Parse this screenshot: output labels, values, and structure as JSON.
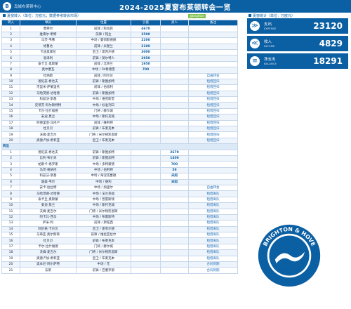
{
  "banner": {
    "org": "岛城布莱顿中心",
    "title": "2024-2025夏窗布莱顿转会一览",
    "logo_text": "B"
  },
  "left_head": "夏窗转入（单位：万欧元；数据参考转会市场）",
  "badge": "@brighton",
  "columns": [
    "转入",
    "球员",
    "位置",
    "引援",
    "卖人",
    "备注"
  ],
  "transfers_in": [
    {
      "no": "1",
      "player": "鲁特尔",
      "pos": "前锋 / 科拉巴",
      "fee": "4670",
      "sold": "",
      "note": ""
    },
    {
      "no": "2",
      "player": "维南尔·明特",
      "pos": "前锋 / 铭主",
      "fee": "3500",
      "sold": "",
      "note": ""
    },
    {
      "no": "3",
      "player": "马茨·韦弗",
      "pos": "中场 / 曼彻斯德赫",
      "fee": "2200",
      "sold": "",
      "note": ""
    },
    {
      "no": "4",
      "player": "格鲁达",
      "pos": "前锋 / 米图兰",
      "fee": "2100",
      "sold": "",
      "note": ""
    },
    {
      "no": "5",
      "player": "卡迪奥库尼",
      "pos": "后卫 / 席内尔德",
      "fee": "3000",
      "sold": "",
      "note": ""
    },
    {
      "no": "6",
      "player": "恩泽利",
      "pos": "前锋 / 莫尔特人",
      "fee": "2950",
      "sold": "",
      "note": ""
    },
    {
      "no": "7",
      "player": "泰卡丘·奥斯蒙",
      "pos": "前锋 / 北英兰",
      "fee": "1950",
      "sold": "",
      "note": ""
    },
    {
      "no": "8",
      "player": "奥尔塞瓦",
      "pos": "中场 / FK希德堡",
      "fee": "700",
      "sold": "",
      "note": ""
    },
    {
      "no": "9",
      "player": "杜纳斯",
      "pos": "前锋 / 阿尔达",
      "fee": "",
      "sold": "",
      "note": "自由转会"
    },
    {
      "no": "10",
      "player": "德尼兹·希达夫",
      "pos": "前锋 / 斯图加特",
      "fee": "",
      "sold": "",
      "note": "租借回归"
    },
    {
      "no": "11",
      "player": "杰里米·萨蒙里托",
      "pos": "前锋 / 伯恩利",
      "fee": "",
      "sold": "",
      "note": "租借回归"
    },
    {
      "no": "12",
      "player": "马哈茂德·达哈德",
      "pos": "前锋 / 斯图加特",
      "fee": "",
      "sold": "",
      "note": "租借回归"
    },
    {
      "no": "13",
      "player": "科兹沃·斯基",
      "pos": "中场 / 维克斯堡",
      "fee": "",
      "sold": "",
      "note": "租借回归"
    },
    {
      "no": "14",
      "player": "史蒂芬·阿尔斯特特",
      "pos": "中场 / 标准列日",
      "fee": "",
      "sold": "",
      "note": "租借回归"
    },
    {
      "no": "15",
      "player": "卡尔·拉什福德",
      "pos": "门将 / 赫尔城",
      "fee": "",
      "sold": "",
      "note": "租借回归"
    },
    {
      "no": "16",
      "player": "安迪·莫兰",
      "pos": "中场 / 斯托克城",
      "fee": "",
      "sold": "",
      "note": "租借回归"
    },
    {
      "no": "17",
      "player": "阿德里亚·马内卢",
      "pos": "前锋 / 维利特",
      "fee": "",
      "sold": "",
      "note": "租借回归"
    },
    {
      "no": "18",
      "player": "杜贝贝",
      "pos": "前锋 / 布莱克本",
      "fee": "",
      "sold": "",
      "note": "租借回归"
    },
    {
      "no": "19",
      "player": "沃姆·麦吉尔",
      "pos": "门将 / 米尔顿凯恩斯",
      "fee": "",
      "sold": "",
      "note": "租借回归"
    },
    {
      "no": "20",
      "player": "奥德卢加·希菲亚",
      "pos": "后卫 / 布莱克本",
      "fee": "",
      "sold": "",
      "note": "租借回归"
    }
  ],
  "out_label": "转出",
  "transfers_out": [
    {
      "no": "1",
      "player": "德尼兹·希达夫",
      "pos": "前锋 / 斯图加特",
      "fee": "",
      "sold": "2670",
      "note": ""
    },
    {
      "no": "2",
      "player": "比利·布尔夫",
      "pos": "前锋 / 斯图加特",
      "fee": "",
      "sold": "1400",
      "note": ""
    },
    {
      "no": "3",
      "player": "帕斯卡·格罗斯",
      "pos": "中场 / 多特蒙德",
      "fee": "",
      "sold": "700",
      "note": ""
    },
    {
      "no": "4",
      "player": "马茨·格纳内",
      "pos": "中场 / 伯利特",
      "fee": "",
      "sold": "59",
      "note": ""
    },
    {
      "no": "5",
      "player": "科兹沃·斯基",
      "pos": "中场 / 海涅克塞德",
      "fee": "",
      "sold": "未知",
      "note": ""
    },
    {
      "no": "6",
      "player": "詹森·韦尔",
      "pos": "中场 / 维利",
      "fee": "",
      "sold": "未知",
      "note": ""
    },
    {
      "no": "7",
      "player": "安卡·拉拉特",
      "pos": "中场 / 加里尔",
      "fee": "",
      "sold": "",
      "note": "自由转会"
    },
    {
      "no": "8",
      "player": "马哈茂德·达哈德",
      "pos": "中场 / 法兰克福",
      "fee": "",
      "sold": "",
      "note": "租借离队"
    },
    {
      "no": "9",
      "player": "泰卡丘·奥斯蒙",
      "pos": "中场 / 普雷斯顿",
      "fee": "",
      "sold": "",
      "note": "租借离队"
    },
    {
      "no": "10",
      "player": "安迪·莫兰",
      "pos": "中场 / 斯托克城",
      "fee": "",
      "sold": "",
      "note": "租借离队"
    },
    {
      "no": "11",
      "player": "沃姆·麦吉尔",
      "pos": "门将 / 米尔顿凯恩斯",
      "fee": "",
      "sold": "",
      "note": "租借离队"
    },
    {
      "no": "12",
      "player": "阿卡比·西马",
      "pos": "中场 / 布雷斯特",
      "fee": "",
      "sold": "",
      "note": "租借离队"
    },
    {
      "no": "13",
      "player": "萨米·利",
      "pos": "前锋 / 斯旺西",
      "fee": "",
      "sold": "",
      "note": "租借离队"
    },
    {
      "no": "14",
      "player": "阿伦格·卡尔贝",
      "pos": "后卫 / 谢菲尔德",
      "fee": "",
      "sold": "",
      "note": "租借离队"
    },
    {
      "no": "15",
      "player": "马蒂亚·奥尔斯蒂",
      "pos": "前锋 / 维拉亚拉尔",
      "fee": "",
      "sold": "",
      "note": "租借离队"
    },
    {
      "no": "16",
      "player": "杜贝贝",
      "pos": "前锋 / 布莱克本",
      "fee": "",
      "sold": "",
      "note": "租借离队"
    },
    {
      "no": "17",
      "player": "卡尔·拉什福德",
      "pos": "门将 / 赫尔城",
      "fee": "",
      "sold": "",
      "note": "租借离队"
    },
    {
      "no": "18",
      "player": "沃姆·麦吉尔",
      "pos": "门将 / 米尔顿凯恩斯",
      "fee": "",
      "sold": "",
      "note": "租借离队"
    },
    {
      "no": "19",
      "player": "奥德卢加·希菲亚",
      "pos": "后卫 / 布莱克本",
      "fee": "",
      "sold": "",
      "note": "租借离队"
    },
    {
      "no": "20",
      "player": "奥本尼·阿尔萨特",
      "pos": "中场 / 无",
      "fee": "",
      "sold": "",
      "note": "合同到期"
    },
    {
      "no": "21",
      "player": "法蒂",
      "pos": "前锋 / 巴塞罗那",
      "fee": "",
      "sold": "",
      "note": "合同到期"
    }
  ],
  "right_head": "夏窗统计（单位：万欧元）",
  "stats": [
    {
      "label": "支出",
      "en": "EXPENSE",
      "value": "23120",
      "icon": "chevron-down-icon",
      "glyph": "≫"
    },
    {
      "label": "收入",
      "en": "INCOME",
      "value": "4829",
      "icon": "chevron-up-icon",
      "glyph": "≪"
    },
    {
      "label": "净支出",
      "en": "BALANCE",
      "value": "18291",
      "icon": "database-icon",
      "glyph": "≡"
    }
  ],
  "crest": {
    "top_text": "BRIGHTON & HOVE",
    "bottom_text": "ALBION",
    "colors": {
      "blue": "#0b5fa3",
      "white": "#ffffff"
    }
  }
}
